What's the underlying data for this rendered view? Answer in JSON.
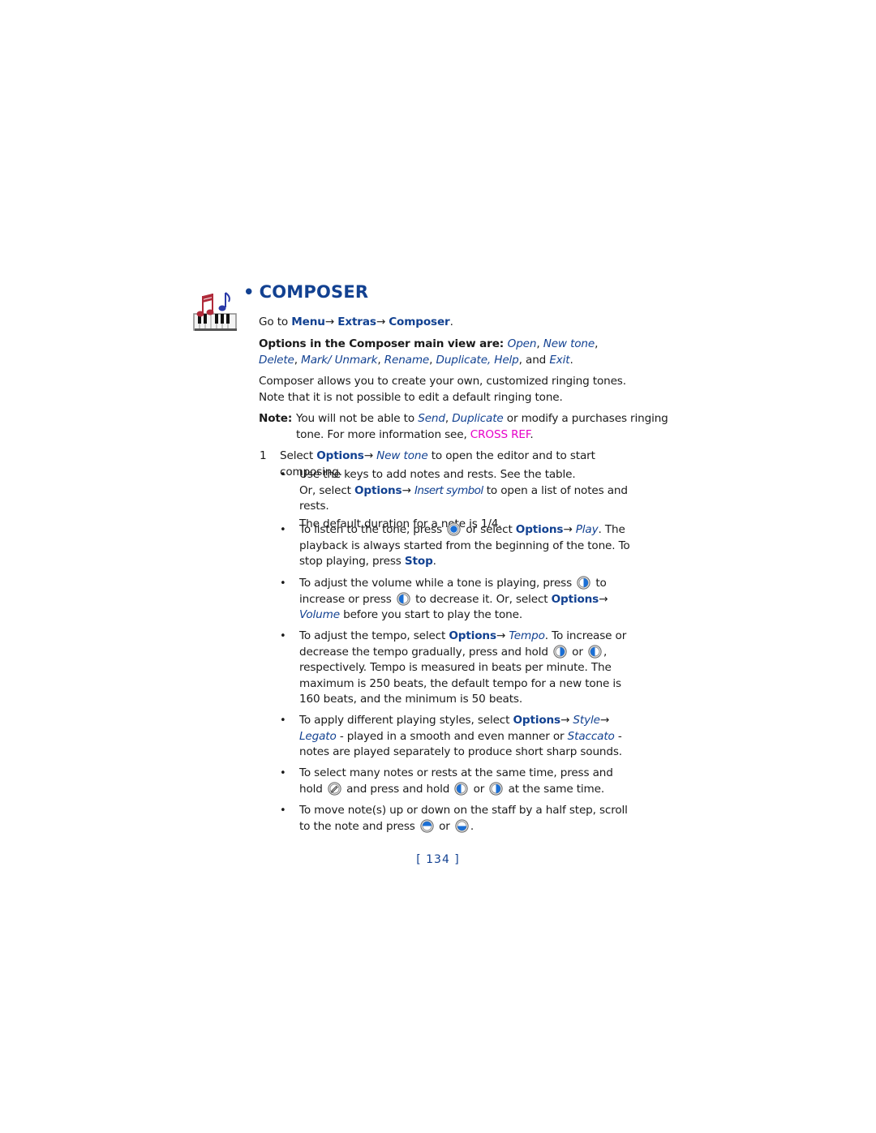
{
  "section": {
    "bullet": "•",
    "title": "COMPOSER",
    "icon": "composer-piano-notes-icon"
  },
  "goto": {
    "prefix": "Go to ",
    "path": [
      "Menu",
      "Extras",
      "Composer"
    ],
    "arrow": "→",
    "suffix": "."
  },
  "options_line": {
    "lead": "Options in the Composer main view are: ",
    "items": [
      "Open",
      "New tone",
      "Delete",
      "Mark/ Unmark",
      "Rename",
      "Duplicate",
      "Help",
      "Exit"
    ],
    "sep": ", ",
    "and": "and "
  },
  "intro": "Composer allows you to create your own, customized ringing tones. Note that it is not possible to edit a default ringing tone.",
  "note": {
    "label": "Note:",
    "text1": "You will not be able to ",
    "link1": "Send",
    "comma": ", ",
    "link2": "Duplicate",
    "text2": " or modify a purchases ringing tone.  For more information see, ",
    "crossref": "CROSS REF",
    "end": "."
  },
  "step1": {
    "number": "1",
    "text_a": "Select ",
    "options": "Options",
    "arrow": "→ ",
    "newtone": "New tone",
    "text_b": " to open the editor and to start composing."
  },
  "bullets": {
    "keys": {
      "line1": "Use the keys to add notes and rests. See the table.",
      "line2a": "Or, select ",
      "options": "Options",
      "arrow": "→ ",
      "insert": "Insert symbol",
      "line2b": " to open a list of notes and rests.",
      "line3": "The default duration for a note is 1/4."
    },
    "listen": {
      "a": "To listen to the tone, press ",
      "b": " or select ",
      "options": "Options",
      "arrow": "→ ",
      "play": "Play",
      "c": ". The playback is always started from the beginning of the tone. To stop playing, press ",
      "stop": "Stop",
      "d": "."
    },
    "volume": {
      "a": "To adjust the volume while a tone is playing, press ",
      "b": " to increase or press ",
      "c": " to decrease it. Or, select ",
      "options": "Options",
      "arrow": "→ ",
      "volume": "Volume",
      "d": " before you start to play the tone."
    },
    "tempo": {
      "a": "To adjust the tempo, select ",
      "options": "Options",
      "arrow": "→ ",
      "tempo": "Tempo",
      "b": ". To increase or decrease the tempo gradually, press and hold ",
      "or": " or ",
      "c": ", respectively. Tempo is measured in beats per minute. The maximum is 250 beats, the default tempo for a new tone is 160 beats, and the minimum is 50 beats."
    },
    "style": {
      "a": "To apply different playing styles, select ",
      "options": "Options",
      "arrow": "→ ",
      "style": "Style",
      "arrow2": "→ ",
      "legato": "Legato",
      "b": " - played in a smooth and even manner or ",
      "staccato": "Staccato",
      "c": " - notes are played separately to produce short sharp sounds."
    },
    "select": {
      "a": "To select many notes or rests at the same time, press and hold ",
      "b": " and press and hold ",
      "or": " or ",
      "c": " at the same time."
    },
    "move": {
      "a": "To move note(s) up or down on the staff by a half step, scroll to the note and press ",
      "or": " or ",
      "c": "."
    }
  },
  "page_number": "[ 134 ]",
  "colors": {
    "accent_blue": "#124191",
    "crossref_magenta": "#e600c8",
    "key_blue": "#1a6fd6"
  }
}
